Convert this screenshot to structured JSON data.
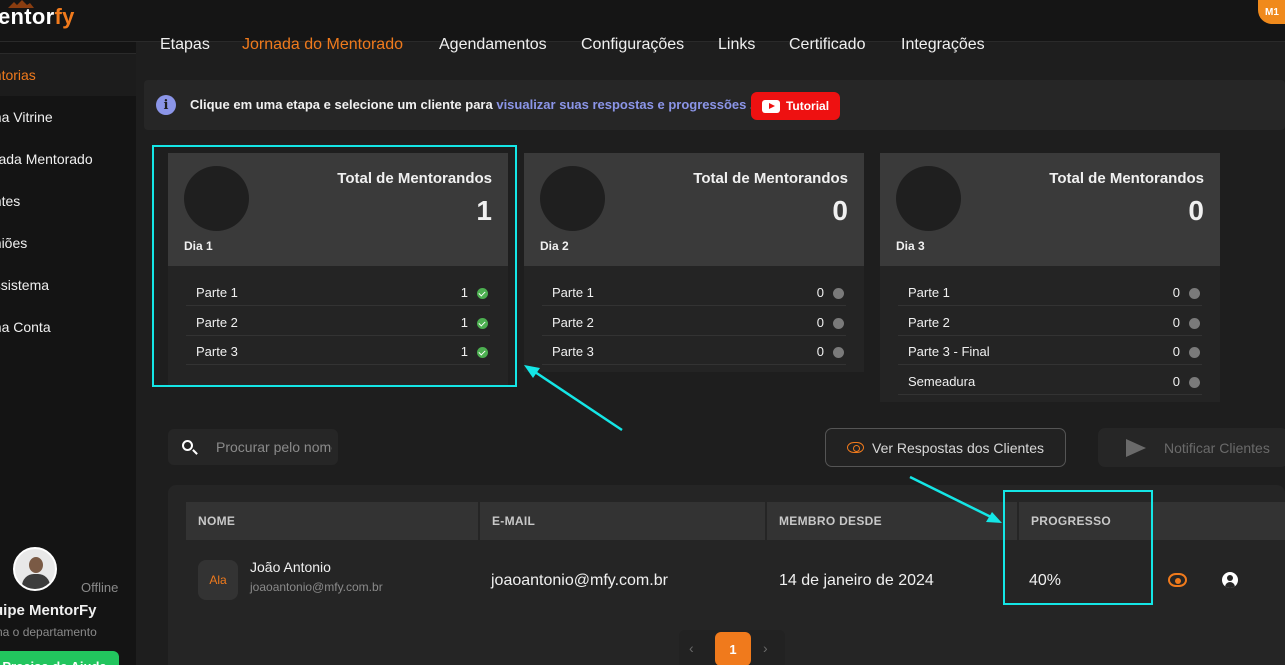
{
  "app": {
    "logo_white": "entor",
    "logo_orange": "fy",
    "user_initials": "M1"
  },
  "tabs": [
    "Etapas",
    "Jornada do Mentorado",
    "Agendamentos",
    "Configurações",
    "Links",
    "Certificado",
    "Integrações"
  ],
  "active_tab": "Jornada do Mentorado",
  "sidebar": {
    "items": [
      "entorias",
      "nha Vitrine",
      "rnada Mentorado",
      "entes",
      "uniões",
      "ossistema",
      "nha Conta"
    ],
    "active_index": 0,
    "user_status": "Offline",
    "user_name": "uipe MentorFy",
    "user_department": "na o departamento",
    "help_button": "Precisa de Ajuda"
  },
  "info": {
    "text": "Clique em uma etapa e selecione um cliente para ",
    "link": "visualizar suas respostas e progressões",
    "suffix": " .",
    "tutorial_button": "Tutorial"
  },
  "cards": [
    {
      "day": "Dia 1",
      "title": "Total de Mentorandos",
      "count": "1",
      "rows": [
        {
          "label": "Parte 1",
          "value": "1",
          "done": true
        },
        {
          "label": "Parte 2",
          "value": "1",
          "done": true
        },
        {
          "label": "Parte 3",
          "value": "1",
          "done": true
        }
      ]
    },
    {
      "day": "Dia 2",
      "title": "Total de Mentorandos",
      "count": "0",
      "rows": [
        {
          "label": "Parte 1",
          "value": "0",
          "done": false
        },
        {
          "label": "Parte 2",
          "value": "0",
          "done": false
        },
        {
          "label": "Parte 3",
          "value": "0",
          "done": false
        }
      ]
    },
    {
      "day": "Dia 3",
      "title": "Total de Mentorandos",
      "count": "0",
      "rows": [
        {
          "label": "Parte 1",
          "value": "0",
          "done": false
        },
        {
          "label": "Parte 2",
          "value": "0",
          "done": false
        },
        {
          "label": "Parte 3 - Final",
          "value": "0",
          "done": false
        },
        {
          "label": "Semeadura",
          "value": "0",
          "done": false
        }
      ]
    }
  ],
  "search": {
    "placeholder": "Procurar pelo nome"
  },
  "actions": {
    "view_answers": "Ver Respostas dos Clientes",
    "notify": "Notificar Clientes"
  },
  "table": {
    "headers": [
      "NOME",
      "E-MAIL",
      "MEMBRO DESDE",
      "PROGRESSO"
    ],
    "rows": [
      {
        "initials": "Ala",
        "name": "João Antonio",
        "email_small": "joaoantonio@mfy.com.br",
        "email": "joaoantonio@mfy.com.br",
        "member_since": "14 de janeiro de 2024",
        "progress": "40%"
      }
    ]
  },
  "pagination": {
    "prev": "‹",
    "current": "1",
    "next": "›"
  },
  "colors": {
    "accent": "#f07a1c",
    "highlight": "#14e6e6",
    "success": "#4caf50",
    "link": "#8b95e8",
    "youtube": "#ee1111"
  }
}
